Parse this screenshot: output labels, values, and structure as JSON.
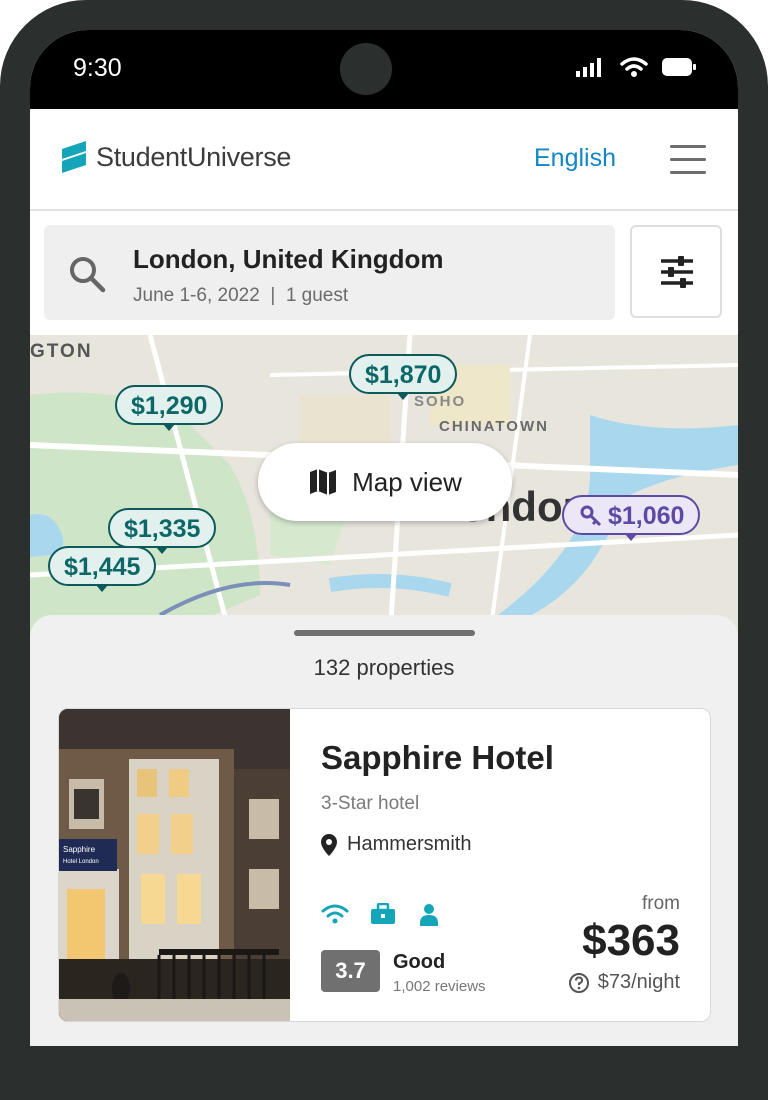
{
  "status_bar": {
    "time": "9:30"
  },
  "header": {
    "brand": "StudentUniverse",
    "language": "English"
  },
  "search": {
    "destination": "London, United Kingdom",
    "details": "June 1-6, 2022  |  1 guest"
  },
  "map": {
    "labels": [
      "GTON",
      "SOHO",
      "CHINATOWN",
      "ondon"
    ],
    "pins": [
      "$1,290",
      "$1,870",
      "$1,335",
      "$1,445",
      "$1,060"
    ],
    "map_view_label": "Map view"
  },
  "results": {
    "count_label": "132 properties"
  },
  "hotel": {
    "name": "Sapphire Hotel",
    "type": "3-Star hotel",
    "location": "Hammersmith",
    "sign_text": "Sapphire Hotel London",
    "amenities": [
      "wifi-icon",
      "briefcase-icon",
      "concierge-icon"
    ],
    "rating": "3.7",
    "rating_word": "Good",
    "reviews": "1,002 reviews",
    "from_label": "from",
    "price": "$363",
    "per_night": "$73/night"
  },
  "colors": {
    "brand_teal": "#14a6b8",
    "link_blue": "#1287c4",
    "pin_teal": "#0c5a5a",
    "pin_purple": "#5e4aa3"
  }
}
